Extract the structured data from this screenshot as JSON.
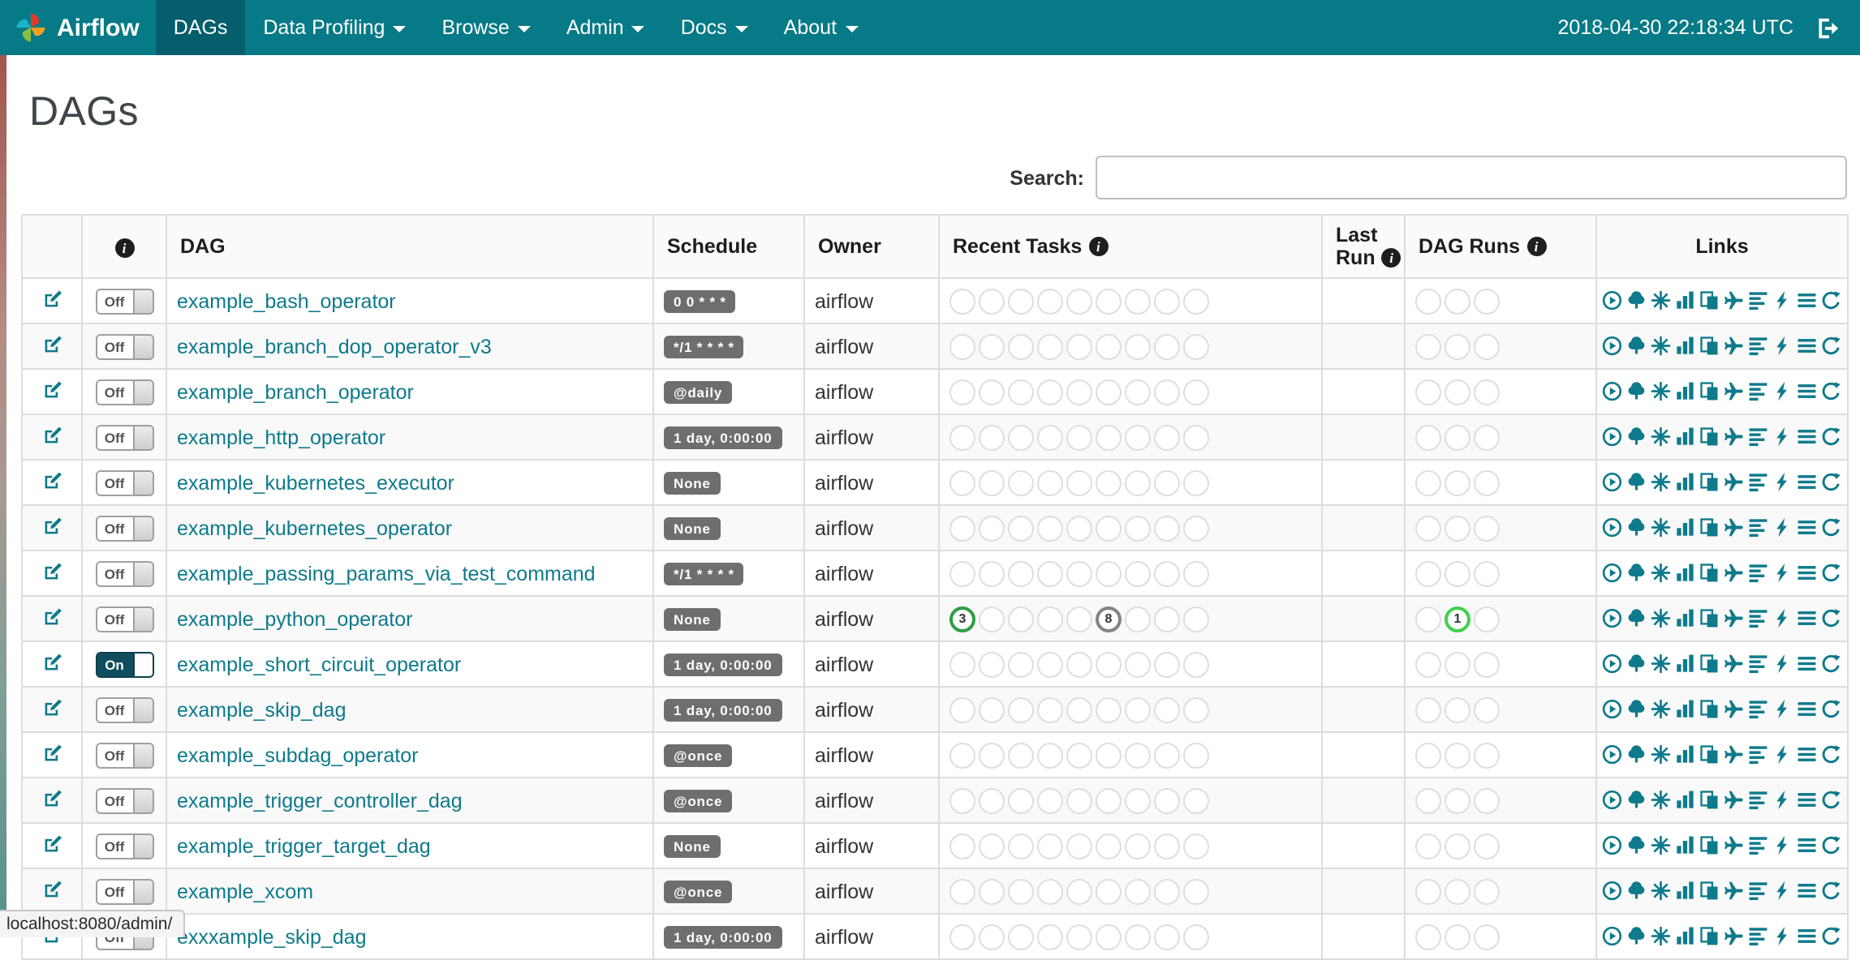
{
  "navbar": {
    "brand": "Airflow",
    "items": [
      {
        "label": "DAGs",
        "active": true,
        "dropdown": false
      },
      {
        "label": "Data Profiling",
        "active": false,
        "dropdown": true
      },
      {
        "label": "Browse",
        "active": false,
        "dropdown": true
      },
      {
        "label": "Admin",
        "active": false,
        "dropdown": true
      },
      {
        "label": "Docs",
        "active": false,
        "dropdown": true
      },
      {
        "label": "About",
        "active": false,
        "dropdown": true
      }
    ],
    "clock": "2018-04-30 22:18:34 UTC"
  },
  "page": {
    "title": "DAGs"
  },
  "search": {
    "label": "Search:",
    "value": ""
  },
  "glyphs": {
    "info": "i"
  },
  "colors": {
    "navbar_bg": "#077a87",
    "navbar_active_bg": "#045e6b",
    "accent": "#0e7a8b",
    "badge_bg": "#6e6e6e",
    "toggle_on_bg": "#104d5f",
    "state_success": "#2f9e44",
    "state_running": "#3fd14a",
    "state_none": "#848484"
  },
  "table": {
    "headers": {
      "dag": "DAG",
      "schedule": "Schedule",
      "owner": "Owner",
      "recent_tasks": "Recent Tasks",
      "last_run_line1": "Last",
      "last_run_line2": "Run",
      "dag_runs": "DAG Runs",
      "links": "Links"
    },
    "recent_task_circle_count": 9,
    "dag_run_circle_count": 3,
    "link_icons": [
      {
        "name": "trigger-dag",
        "glyph": "play-circle"
      },
      {
        "name": "tree-view",
        "glyph": "tree"
      },
      {
        "name": "graph-view",
        "glyph": "graph-burst"
      },
      {
        "name": "tasks-duration",
        "glyph": "bar-chart"
      },
      {
        "name": "task-tries",
        "glyph": "duplicate"
      },
      {
        "name": "landing-times",
        "glyph": "plane"
      },
      {
        "name": "gantt-view",
        "glyph": "align-left"
      },
      {
        "name": "code-view",
        "glyph": "flash"
      },
      {
        "name": "logs",
        "glyph": "list-lines"
      },
      {
        "name": "refresh",
        "glyph": "refresh-arrow"
      }
    ],
    "rows": [
      {
        "name": "example_bash_operator",
        "toggle": "Off",
        "schedule": "0 0 * * *",
        "owner": "airflow",
        "last_run": "",
        "recent_tasks": [],
        "dag_runs": []
      },
      {
        "name": "example_branch_dop_operator_v3",
        "toggle": "Off",
        "schedule": "*/1 * * * *",
        "owner": "airflow",
        "last_run": "",
        "recent_tasks": [],
        "dag_runs": []
      },
      {
        "name": "example_branch_operator",
        "toggle": "Off",
        "schedule": "@daily",
        "owner": "airflow",
        "last_run": "",
        "recent_tasks": [],
        "dag_runs": []
      },
      {
        "name": "example_http_operator",
        "toggle": "Off",
        "schedule": "1 day, 0:00:00",
        "owner": "airflow",
        "last_run": "",
        "recent_tasks": [],
        "dag_runs": []
      },
      {
        "name": "example_kubernetes_executor",
        "toggle": "Off",
        "schedule": "None",
        "owner": "airflow",
        "last_run": "",
        "recent_tasks": [],
        "dag_runs": []
      },
      {
        "name": "example_kubernetes_operator",
        "toggle": "Off",
        "schedule": "None",
        "owner": "airflow",
        "last_run": "",
        "recent_tasks": [],
        "dag_runs": []
      },
      {
        "name": "example_passing_params_via_test_command",
        "toggle": "Off",
        "schedule": "*/1 * * * *",
        "owner": "airflow",
        "last_run": "",
        "recent_tasks": [],
        "dag_runs": []
      },
      {
        "name": "example_python_operator",
        "toggle": "Off",
        "schedule": "None",
        "owner": "airflow",
        "last_run": "",
        "recent_tasks": [
          {
            "index": 0,
            "count": "3",
            "state": "success"
          },
          {
            "index": 5,
            "count": "8",
            "state": "none"
          }
        ],
        "dag_runs": [
          {
            "index": 1,
            "count": "1",
            "state": "running"
          }
        ]
      },
      {
        "name": "example_short_circuit_operator",
        "toggle": "On",
        "schedule": "1 day, 0:00:00",
        "owner": "airflow",
        "last_run": "",
        "recent_tasks": [],
        "dag_runs": []
      },
      {
        "name": "example_skip_dag",
        "toggle": "Off",
        "schedule": "1 day, 0:00:00",
        "owner": "airflow",
        "last_run": "",
        "recent_tasks": [],
        "dag_runs": []
      },
      {
        "name": "example_subdag_operator",
        "toggle": "Off",
        "schedule": "@once",
        "owner": "airflow",
        "last_run": "",
        "recent_tasks": [],
        "dag_runs": []
      },
      {
        "name": "example_trigger_controller_dag",
        "toggle": "Off",
        "schedule": "@once",
        "owner": "airflow",
        "last_run": "",
        "recent_tasks": [],
        "dag_runs": []
      },
      {
        "name": "example_trigger_target_dag",
        "toggle": "Off",
        "schedule": "None",
        "owner": "airflow",
        "last_run": "",
        "recent_tasks": [],
        "dag_runs": []
      },
      {
        "name": "example_xcom",
        "toggle": "Off",
        "schedule": "@once",
        "owner": "airflow",
        "last_run": "",
        "recent_tasks": [],
        "dag_runs": []
      },
      {
        "name": "exxxample_skip_dag",
        "toggle": "Off",
        "schedule": "1 day, 0:00:00",
        "owner": "airflow",
        "last_run": "",
        "recent_tasks": [],
        "dag_runs": []
      }
    ]
  },
  "status_bar": {
    "text": "localhost:8080/admin/"
  }
}
